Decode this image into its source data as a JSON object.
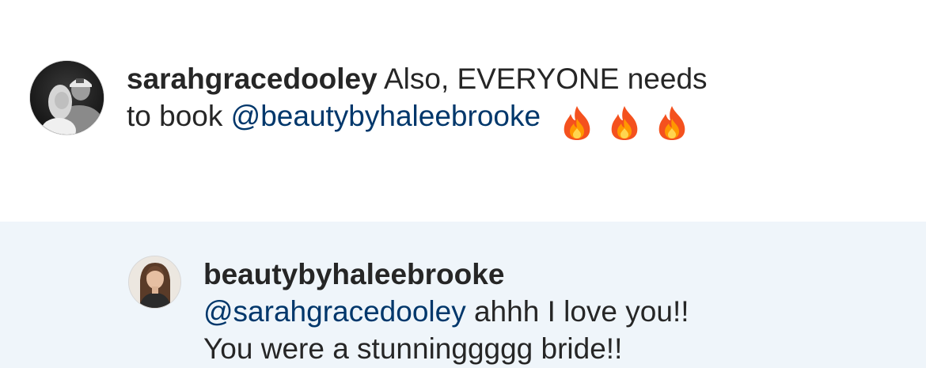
{
  "comment": {
    "username": "sarahgracedooley",
    "text_line1": "Also, EVERYONE needs",
    "text_line2_prefix": "to book",
    "mention": "@beautybyhaleebrooke",
    "emoji_count": 3,
    "emoji_icon": "fire-icon",
    "avatar_icon": "profile-photo-couple"
  },
  "reply": {
    "username": "beautybyhaleebrooke",
    "mention": "@sarahgracedooley",
    "text_line1": "ahhh I love you!!",
    "text_line2": "You were a stunninggggg bride!!",
    "avatar_icon": "profile-photo-woman"
  },
  "colors": {
    "text": "#262626",
    "mention": "#00376b",
    "reply_background": "#eff5fa",
    "background": "#ffffff"
  }
}
